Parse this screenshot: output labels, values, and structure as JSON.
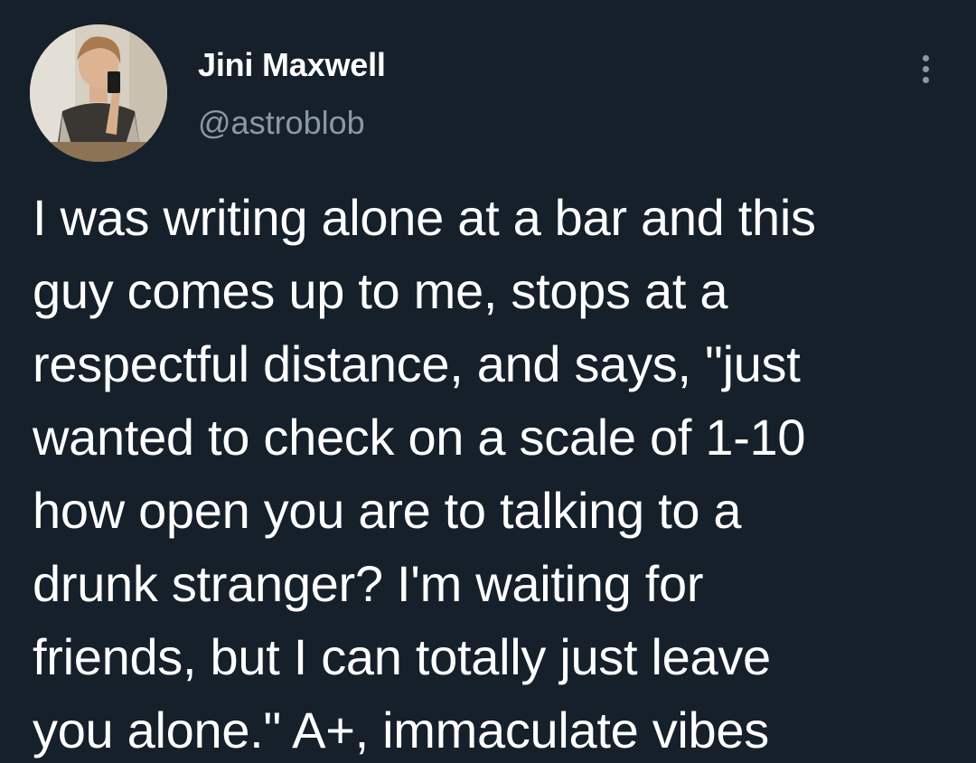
{
  "author": {
    "display_name": "Jini Maxwell",
    "handle": "@astroblob"
  },
  "icons": {
    "more": "more-options-icon",
    "avatar": "profile-photo"
  },
  "tweet": {
    "text": "I was writing alone at a bar and this\nguy comes up to me, stops at a\nrespectful distance, and says, \"just\nwanted to check on a scale of 1-10\nhow open you are to talking to a\ndrunk stranger? I'm waiting for\nfriends, but I can totally just leave\nyou alone.\" A+, immaculate vibes"
  },
  "colors": {
    "background": "#15202b",
    "primary_text": "#ffffff",
    "secondary_text": "#8b98a5"
  }
}
